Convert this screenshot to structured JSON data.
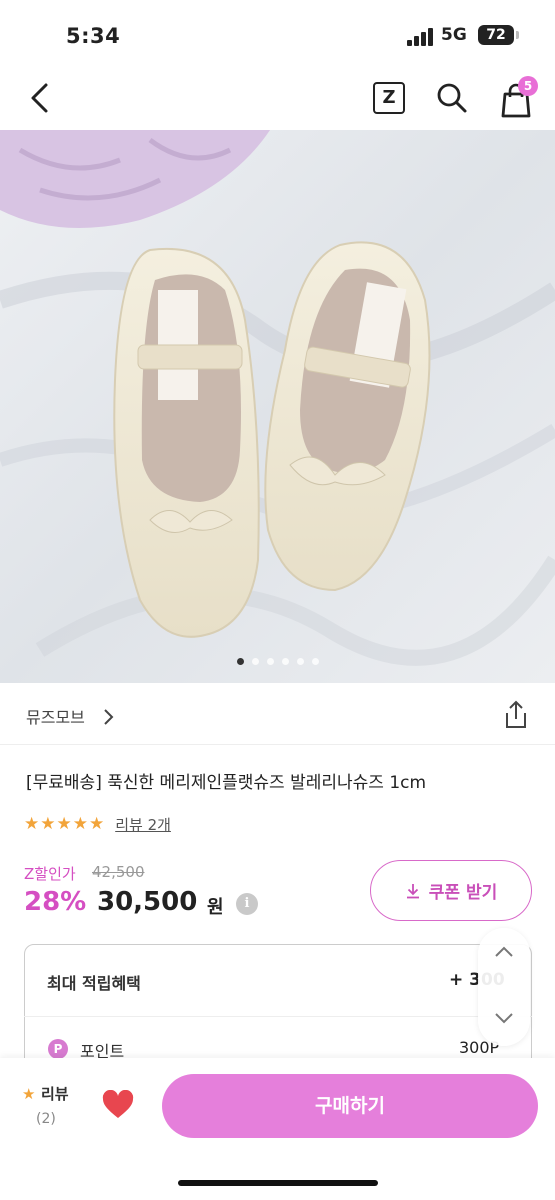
{
  "status_bar": {
    "time": "5:34",
    "network": "5G",
    "battery": "72"
  },
  "nav": {
    "z_label": "Z",
    "cart_count": "5"
  },
  "product": {
    "brand": "뮤즈모브",
    "title": "[무료배송] 푹신한 메리제인플랫슈즈 발레리나슈즈 1cm",
    "stars": "★★★★★",
    "review_link": "리뷰 2개",
    "discount_label": "Z할인가",
    "original_price": "42,500",
    "discount_rate": "28%",
    "sale_price": "30,500",
    "currency": "원",
    "info_icon": "i",
    "coupon_label": "쿠폰 받기",
    "image_dots": 6,
    "active_dot": 0
  },
  "rewards": {
    "title": "최대 적립혜택",
    "value": "+ 300",
    "point_icon": "P",
    "point_label": "포인트",
    "point_value": "300P"
  },
  "bottom": {
    "review_star": "★",
    "review_label": "리뷰",
    "review_count": "(2)",
    "buy_label": "구매하기"
  },
  "colors": {
    "accent": "#e57fdb",
    "accent_text": "#d54fc2",
    "star": "#f2a43a",
    "heart": "#e8464f"
  },
  "icons": [
    "back-chevron-icon",
    "z-icon",
    "search-icon",
    "shopping-bag-icon",
    "chevron-right-icon",
    "share-icon",
    "download-icon",
    "info-icon",
    "heart-icon",
    "chevron-up-icon",
    "chevron-down-icon"
  ]
}
